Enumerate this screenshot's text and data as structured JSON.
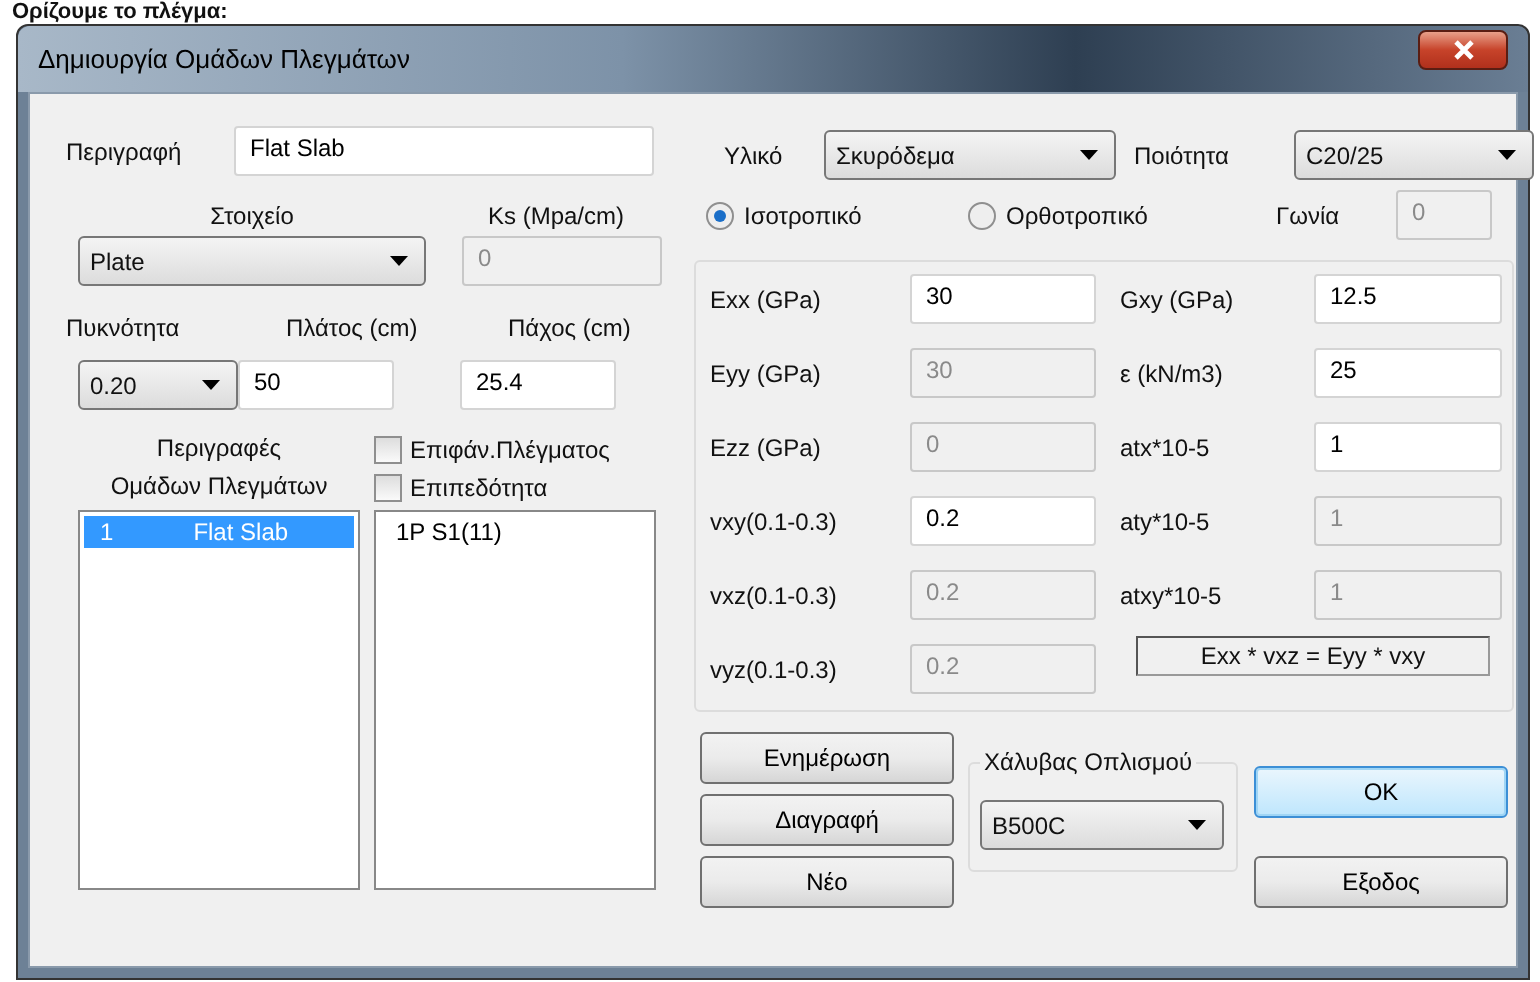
{
  "heading": "Ορίζουμε το πλέγμα:",
  "window": {
    "title": "Δημιουργία Ομάδων Πλεγμάτων"
  },
  "description": {
    "label": "Περιγραφή",
    "value": "Flat Slab"
  },
  "element": {
    "label": "Στοιχείο",
    "value": "Plate"
  },
  "ks": {
    "label": "Ks (Mpa/cm)",
    "value": "0",
    "disabled": true
  },
  "density": {
    "label": "Πυκνότητα",
    "value": "0.20"
  },
  "width": {
    "label": "Πλάτος (cm)",
    "value": "50",
    "disabled": false
  },
  "thickness": {
    "label": "Πάχος (cm)",
    "value": "25.4",
    "disabled": false
  },
  "groups": {
    "label_lines": [
      "Περιγραφές",
      "Ομάδων Πλεγμάτων"
    ],
    "items": [
      {
        "number": "1",
        "name": "Flat Slab",
        "selected": true
      }
    ]
  },
  "checkboxes": [
    {
      "label": "Επιφάν.Πλέγματος",
      "checked": false
    },
    {
      "label": "Επιπεδότητα",
      "checked": false
    }
  ],
  "surfaces": {
    "items": [
      {
        "label": "1P S1(11)",
        "selected": false
      }
    ]
  },
  "material": {
    "label": "Υλικό",
    "value": "Σκυρόδεμα"
  },
  "quality": {
    "label": "Ποιότητα",
    "value": "C20/25"
  },
  "anisotropy": [
    {
      "label": "Ισοτροπικό",
      "selected": true
    },
    {
      "label": "Ορθοτροπικό",
      "selected": false
    }
  ],
  "angle": {
    "label": "Γωνία",
    "value": "0",
    "disabled": true
  },
  "properties": {
    "left": [
      {
        "label": "Exx (GPa)",
        "value": "30",
        "disabled": false
      },
      {
        "label": "Eyy (GPa)",
        "value": "30",
        "disabled": true
      },
      {
        "label": "Ezz (GPa)",
        "value": "0",
        "disabled": true
      },
      {
        "label": "vxy(0.1-0.3)",
        "value": "0.2",
        "disabled": false
      },
      {
        "label": "vxz(0.1-0.3)",
        "value": "0.2",
        "disabled": true
      },
      {
        "label": "vyz(0.1-0.3)",
        "value": "0.2",
        "disabled": true
      }
    ],
    "right": [
      {
        "label": "Gxy (GPa)",
        "value": "12.5",
        "disabled": false
      },
      {
        "label": "ε (kN/m3)",
        "value": "25",
        "disabled": false
      },
      {
        "label": "atx*10-5",
        "value": "1",
        "disabled": false
      },
      {
        "label": "aty*10-5",
        "value": "1",
        "disabled": true
      },
      {
        "label": "atxy*10-5",
        "value": "1",
        "disabled": true
      }
    ],
    "formula": "Exx * vxz = Eyy * vxy"
  },
  "actions": [
    "Ενημέρωση",
    "Διαγραφή",
    "Νέο"
  ],
  "steel": {
    "label": "Χάλυβας Οπλισμού",
    "value": "B500C"
  },
  "dialog_buttons": [
    {
      "label": "OK",
      "default": true
    },
    {
      "label": "Εξοδος",
      "default": false
    }
  ]
}
